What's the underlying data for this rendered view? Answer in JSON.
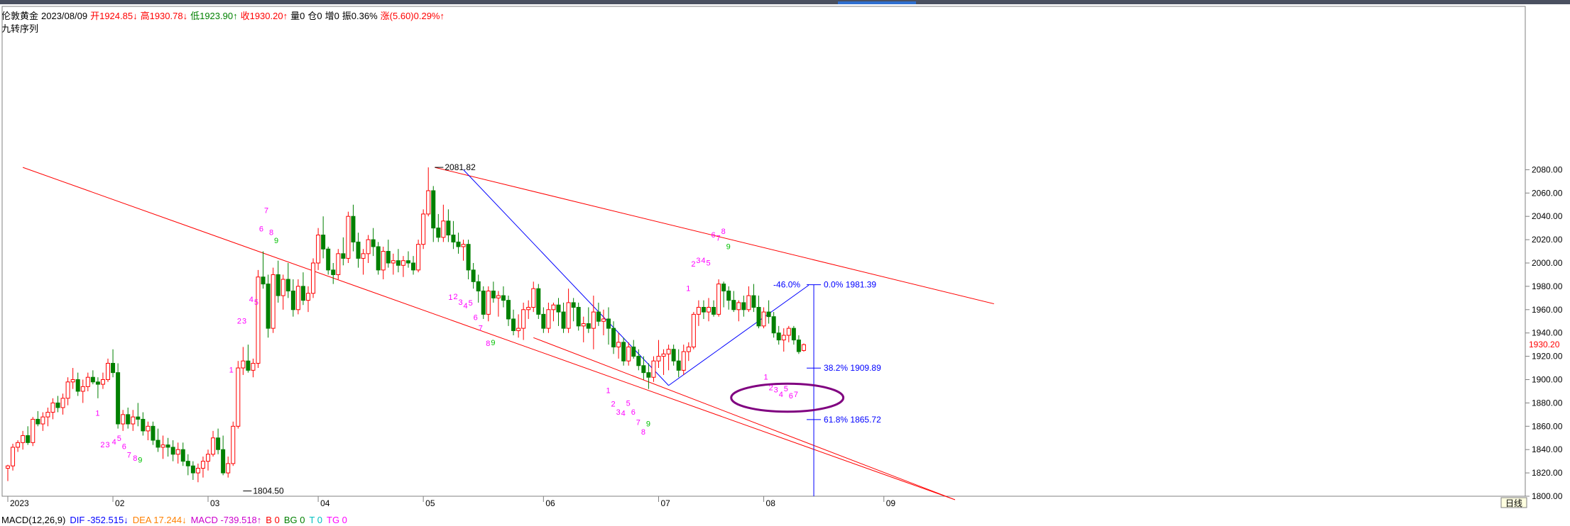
{
  "header": {
    "instrument": "伦敦黄金",
    "date": "2023/08/09",
    "open": "开1924.85↓",
    "high": "高1930.78↓",
    "low": "低1923.90↑",
    "close": "收1930.20↑",
    "volume": "量0",
    "position": "仓0",
    "increase": "增0",
    "amplitude": "振0.36%",
    "change": "涨(5.60)0.29%↑",
    "indicator_name": "九转序列"
  },
  "macd_bar": {
    "name": "MACD(12,26,9)",
    "dif": "DIF -352.515↓",
    "dea": "DEA 17.244↓",
    "macd": "MACD -739.518↑",
    "b": "B 0",
    "bg": "BG 0",
    "t": "T 0",
    "tg": "TG 0"
  },
  "colors": {
    "up": "#ff0000",
    "down": "#008000",
    "channel": "#ff0000",
    "fib": "#0000ff",
    "ellipse": "#800080",
    "td": "#ff00ff",
    "td9": "#00c000"
  },
  "chart_data": {
    "type": "candlestick",
    "ylim": [
      1800,
      2090
    ],
    "ytick_values": [
      1800,
      1820,
      1840,
      1860,
      1880,
      1900,
      1920,
      1940,
      1960,
      1980,
      2000,
      2020,
      2040,
      2060,
      2080
    ],
    "ytick_labels": [
      "1800.00",
      "1820.00",
      "1840.00",
      "1860.00",
      "1880.00",
      "1900.00",
      "1920.00",
      "1940.00",
      "1960.00",
      "1980.00",
      "2000.00",
      "2020.00",
      "2040.00",
      "2060.00",
      "2080.00"
    ],
    "x_labels": [
      {
        "i": 0,
        "t": "2023"
      },
      {
        "i": 21,
        "t": "02"
      },
      {
        "i": 40,
        "t": "03"
      },
      {
        "i": 62,
        "t": "04"
      },
      {
        "i": 83,
        "t": "05"
      },
      {
        "i": 107,
        "t": "06"
      },
      {
        "i": 130,
        "t": "07"
      },
      {
        "i": 151,
        "t": "08"
      },
      {
        "i": 175,
        "t": "09"
      }
    ],
    "x_period_label": "日线",
    "last_price_label": "1930.20",
    "candles": [
      [
        1824,
        1827,
        1813,
        1826
      ],
      [
        1826,
        1845,
        1822,
        1842
      ],
      [
        1842,
        1848,
        1838,
        1846
      ],
      [
        1846,
        1856,
        1840,
        1852
      ],
      [
        1852,
        1860,
        1844,
        1846
      ],
      [
        1846,
        1868,
        1843,
        1866
      ],
      [
        1866,
        1873,
        1860,
        1862
      ],
      [
        1862,
        1872,
        1856,
        1868
      ],
      [
        1868,
        1876,
        1860,
        1872
      ],
      [
        1872,
        1884,
        1866,
        1880
      ],
      [
        1880,
        1886,
        1872,
        1876
      ],
      [
        1876,
        1888,
        1870,
        1884
      ],
      [
        1884,
        1902,
        1878,
        1898
      ],
      [
        1898,
        1910,
        1892,
        1900
      ],
      [
        1900,
        1906,
        1886,
        1890
      ],
      [
        1890,
        1900,
        1880,
        1894
      ],
      [
        1894,
        1906,
        1890,
        1902
      ],
      [
        1902,
        1908,
        1896,
        1898
      ],
      [
        1898,
        1902,
        1884,
        1896
      ],
      [
        1896,
        1906,
        1892,
        1900
      ],
      [
        1900,
        1918,
        1898,
        1914
      ],
      [
        1914,
        1926,
        1902,
        1906
      ],
      [
        1906,
        1914,
        1858,
        1862
      ],
      [
        1862,
        1874,
        1856,
        1870
      ],
      [
        1870,
        1876,
        1858,
        1862
      ],
      [
        1862,
        1874,
        1856,
        1868
      ],
      [
        1868,
        1880,
        1860,
        1866
      ],
      [
        1866,
        1872,
        1852,
        1856
      ],
      [
        1856,
        1864,
        1848,
        1860
      ],
      [
        1860,
        1864,
        1844,
        1848
      ],
      [
        1848,
        1858,
        1838,
        1842
      ],
      [
        1842,
        1852,
        1832,
        1844
      ],
      [
        1844,
        1850,
        1834,
        1842
      ],
      [
        1842,
        1848,
        1830,
        1836
      ],
      [
        1836,
        1846,
        1828,
        1840
      ],
      [
        1840,
        1846,
        1826,
        1830
      ],
      [
        1830,
        1836,
        1818,
        1826
      ],
      [
        1826,
        1830,
        1814,
        1820
      ],
      [
        1820,
        1828,
        1812,
        1824
      ],
      [
        1824,
        1834,
        1816,
        1830
      ],
      [
        1830,
        1840,
        1822,
        1836
      ],
      [
        1836,
        1856,
        1834,
        1850
      ],
      [
        1850,
        1858,
        1836,
        1840
      ],
      [
        1840,
        1852,
        1818,
        1820
      ],
      [
        1820,
        1834,
        1816,
        1828
      ],
      [
        1828,
        1864,
        1826,
        1860
      ],
      [
        1860,
        1916,
        1858,
        1910
      ],
      [
        1910,
        1928,
        1904,
        1916
      ],
      [
        1916,
        1930,
        1906,
        1908
      ],
      [
        1908,
        1918,
        1902,
        1914
      ],
      [
        1914,
        1994,
        1910,
        1988
      ],
      [
        1988,
        2010,
        1978,
        1982
      ],
      [
        1982,
        1990,
        1936,
        1944
      ],
      [
        1944,
        1996,
        1940,
        1990
      ],
      [
        1990,
        2002,
        1966,
        1972
      ],
      [
        1972,
        1990,
        1960,
        1986
      ],
      [
        1986,
        2000,
        1970,
        1976
      ],
      [
        1976,
        1986,
        1954,
        1960
      ],
      [
        1960,
        1986,
        1956,
        1980
      ],
      [
        1980,
        1992,
        1964,
        1968
      ],
      [
        1968,
        1980,
        1958,
        1974
      ],
      [
        1974,
        2004,
        1970,
        2000
      ],
      [
        2000,
        2030,
        1994,
        2024
      ],
      [
        2024,
        2040,
        2004,
        2012
      ],
      [
        2012,
        2014,
        1990,
        1994
      ],
      [
        1994,
        2000,
        1982,
        1990
      ],
      [
        1990,
        2012,
        1986,
        2008
      ],
      [
        2008,
        2022,
        1998,
        2004
      ],
      [
        2004,
        2044,
        2000,
        2040
      ],
      [
        2040,
        2050,
        2010,
        2018
      ],
      [
        2018,
        2026,
        1996,
        2004
      ],
      [
        2004,
        2012,
        1990,
        2008
      ],
      [
        2008,
        2024,
        2000,
        2020
      ],
      [
        2020,
        2030,
        2006,
        2014
      ],
      [
        2014,
        2018,
        1990,
        1994
      ],
      [
        1994,
        2014,
        1986,
        2010
      ],
      [
        2010,
        2020,
        1996,
        2000
      ],
      [
        2000,
        2008,
        1990,
        2002
      ],
      [
        2002,
        2012,
        1992,
        1998
      ],
      [
        1998,
        2006,
        1988,
        2002
      ],
      [
        2002,
        2010,
        1996,
        2000
      ],
      [
        2000,
        2006,
        1990,
        1994
      ],
      [
        1994,
        2020,
        1992,
        2016
      ],
      [
        2016,
        2046,
        2012,
        2042
      ],
      [
        2042,
        2082,
        2040,
        2062
      ],
      [
        2062,
        2066,
        2018,
        2030
      ],
      [
        2030,
        2042,
        2018,
        2022
      ],
      [
        2022,
        2050,
        2018,
        2036
      ],
      [
        2036,
        2046,
        2018,
        2024
      ],
      [
        2024,
        2036,
        2012,
        2018
      ],
      [
        2018,
        2026,
        2008,
        2014
      ],
      [
        2014,
        2020,
        2002,
        2016
      ],
      [
        2016,
        2020,
        1986,
        1994
      ],
      [
        1994,
        2000,
        1978,
        1984
      ],
      [
        1984,
        1990,
        1966,
        1976
      ],
      [
        1976,
        1980,
        1952,
        1956
      ],
      [
        1956,
        1980,
        1950,
        1976
      ],
      [
        1976,
        1984,
        1966,
        1970
      ],
      [
        1970,
        1976,
        1954,
        1972
      ],
      [
        1972,
        1980,
        1962,
        1968
      ],
      [
        1968,
        1972,
        1946,
        1952
      ],
      [
        1952,
        1960,
        1938,
        1942
      ],
      [
        1942,
        1956,
        1936,
        1944
      ],
      [
        1944,
        1966,
        1934,
        1960
      ],
      [
        1960,
        1968,
        1952,
        1962
      ],
      [
        1962,
        1984,
        1958,
        1978
      ],
      [
        1978,
        1982,
        1952,
        1956
      ],
      [
        1956,
        1962,
        1940,
        1944
      ],
      [
        1944,
        1966,
        1940,
        1960
      ],
      [
        1960,
        1966,
        1950,
        1964
      ],
      [
        1964,
        1970,
        1946,
        1958
      ],
      [
        1958,
        1966,
        1940,
        1944
      ],
      [
        1944,
        1978,
        1940,
        1966
      ],
      [
        1966,
        1970,
        1950,
        1962
      ],
      [
        1962,
        1966,
        1942,
        1946
      ],
      [
        1946,
        1954,
        1932,
        1948
      ],
      [
        1948,
        1962,
        1940,
        1944
      ],
      [
        1944,
        1972,
        1926,
        1958
      ],
      [
        1958,
        1966,
        1946,
        1950
      ],
      [
        1950,
        1960,
        1938,
        1952
      ],
      [
        1952,
        1962,
        1930,
        1944
      ],
      [
        1944,
        1950,
        1922,
        1928
      ],
      [
        1928,
        1940,
        1918,
        1932
      ],
      [
        1932,
        1936,
        1912,
        1916
      ],
      [
        1916,
        1932,
        1912,
        1928
      ],
      [
        1928,
        1934,
        1918,
        1920
      ],
      [
        1920,
        1926,
        1908,
        1912
      ],
      [
        1912,
        1920,
        1900,
        1906
      ],
      [
        1906,
        1914,
        1892,
        1902
      ],
      [
        1902,
        1920,
        1898,
        1916
      ],
      [
        1916,
        1934,
        1910,
        1920
      ],
      [
        1920,
        1926,
        1904,
        1922
      ],
      [
        1922,
        1930,
        1908,
        1926
      ],
      [
        1926,
        1930,
        1912,
        1916
      ],
      [
        1916,
        1926,
        1902,
        1908
      ],
      [
        1908,
        1930,
        1904,
        1924
      ],
      [
        1924,
        1932,
        1916,
        1928
      ],
      [
        1928,
        1958,
        1926,
        1956
      ],
      [
        1956,
        1968,
        1946,
        1962
      ],
      [
        1962,
        1968,
        1952,
        1958
      ],
      [
        1958,
        1970,
        1950,
        1962
      ],
      [
        1962,
        1968,
        1954,
        1956
      ],
      [
        1956,
        1986,
        1954,
        1982
      ],
      [
        1982,
        1984,
        1962,
        1976
      ],
      [
        1976,
        1980,
        1960,
        1968
      ],
      [
        1968,
        1976,
        1958,
        1960
      ],
      [
        1960,
        1968,
        1950,
        1966
      ],
      [
        1966,
        1972,
        1954,
        1960
      ],
      [
        1960,
        1980,
        1958,
        1972
      ],
      [
        1972,
        1982,
        1958,
        1962
      ],
      [
        1962,
        1972,
        1944,
        1946
      ],
      [
        1946,
        1962,
        1944,
        1958
      ],
      [
        1958,
        1968,
        1948,
        1954
      ],
      [
        1954,
        1958,
        1936,
        1940
      ],
      [
        1940,
        1946,
        1930,
        1934
      ],
      [
        1934,
        1944,
        1924,
        1938
      ],
      [
        1938,
        1946,
        1932,
        1944
      ],
      [
        1944,
        1946,
        1930,
        1934
      ],
      [
        1934,
        1938,
        1922,
        1924
      ],
      [
        1925,
        1931,
        1924,
        1930
      ]
    ],
    "annotations": [
      {
        "text": "1804.50",
        "x": 47,
        "y": 1804.5
      },
      {
        "text": "2081.82",
        "x": 85.3,
        "y": 2082
      }
    ],
    "channel": {
      "upper": [
        {
          "x": 85.3,
          "y": 2082
        },
        {
          "x": 197,
          "y": 1965
        }
      ],
      "lower": [
        {
          "x": 3,
          "y": 2082
        },
        {
          "x": 189.2,
          "y": 1797
        }
      ],
      "lower2": [
        {
          "x": 105,
          "y": 1936
        },
        {
          "x": 189.2,
          "y": 1797
        }
      ]
    },
    "trend_lines": [
      {
        "from": {
          "x": 91,
          "y": 2080
        },
        "to": {
          "x": 132,
          "y": 1895
        }
      },
      {
        "from": {
          "x": 132,
          "y": 1895
        },
        "to": {
          "x": 160,
          "y": 1981
        }
      }
    ],
    "fib": {
      "x": 161,
      "top": 1981.39,
      "bottom": 1800,
      "levels": [
        {
          "label": "0.0% 1981.39",
          "y": 1981.39
        },
        {
          "label": "38.2% 1909.89",
          "y": 1909.89
        },
        {
          "label": "61.8% 1865.72",
          "y": 1865.72
        }
      ],
      "pct_label": "-46.0%"
    },
    "ellipse": {
      "cx": 155.7,
      "cy": 1884.5,
      "rx": 11.2,
      "ry": 12
    },
    "td_counts": [
      {
        "t": "1",
        "x": 17.5,
        "y": 1869
      },
      {
        "t": "2",
        "x": 18.5,
        "y": 1842
      },
      {
        "t": "3",
        "x": 19.5,
        "y": 1842
      },
      {
        "t": "4",
        "x": 20.8,
        "y": 1844.5
      },
      {
        "t": "5",
        "x": 21.8,
        "y": 1847.5
      },
      {
        "t": "6",
        "x": 22.8,
        "y": 1840.5
      },
      {
        "t": "7",
        "x": 23.8,
        "y": 1833
      },
      {
        "t": "8",
        "x": 25,
        "y": 1830.5
      },
      {
        "t": "9",
        "x": 26,
        "y": 1829
      },
      {
        "t": "1",
        "x": 44.2,
        "y": 1906
      },
      {
        "t": "2",
        "x": 45.8,
        "y": 1948
      },
      {
        "t": "3",
        "x": 46.8,
        "y": 1948
      },
      {
        "t": "4",
        "x": 48.2,
        "y": 1966.5
      },
      {
        "t": "5",
        "x": 49.2,
        "y": 1964
      },
      {
        "t": "6",
        "x": 50.2,
        "y": 2027
      },
      {
        "t": "7",
        "x": 51.2,
        "y": 2043
      },
      {
        "t": "8",
        "x": 52.2,
        "y": 2024
      },
      {
        "t": "9",
        "x": 53.2,
        "y": 2017
      },
      {
        "t": "1",
        "x": 88,
        "y": 1968.5
      },
      {
        "t": "2",
        "x": 89,
        "y": 1969
      },
      {
        "t": "3",
        "x": 90,
        "y": 1964
      },
      {
        "t": "4",
        "x": 91,
        "y": 1961
      },
      {
        "t": "5",
        "x": 92,
        "y": 1963.5
      },
      {
        "t": "6",
        "x": 93,
        "y": 1951
      },
      {
        "t": "7",
        "x": 94,
        "y": 1942
      },
      {
        "t": "8",
        "x": 95.5,
        "y": 1929
      },
      {
        "t": "9",
        "x": 96.5,
        "y": 1929.5
      },
      {
        "t": "1",
        "x": 119.5,
        "y": 1888.5
      },
      {
        "t": "2",
        "x": 120.5,
        "y": 1877
      },
      {
        "t": "3",
        "x": 121.5,
        "y": 1870
      },
      {
        "t": "4",
        "x": 122.5,
        "y": 1869
      },
      {
        "t": "5",
        "x": 123.5,
        "y": 1877.5
      },
      {
        "t": "6",
        "x": 124.5,
        "y": 1870
      },
      {
        "t": "7",
        "x": 125.5,
        "y": 1861
      },
      {
        "t": "8",
        "x": 126.5,
        "y": 1853
      },
      {
        "t": "9",
        "x": 127.5,
        "y": 1860
      },
      {
        "t": "1",
        "x": 135.5,
        "y": 1976
      },
      {
        "t": "2",
        "x": 136.5,
        "y": 1997
      },
      {
        "t": "3",
        "x": 137.5,
        "y": 2000
      },
      {
        "t": "4",
        "x": 138.5,
        "y": 2000
      },
      {
        "t": "5",
        "x": 139.5,
        "y": 1998
      },
      {
        "t": "6",
        "x": 140.5,
        "y": 2022
      },
      {
        "t": "7",
        "x": 141.5,
        "y": 2019
      },
      {
        "t": "8",
        "x": 142.5,
        "y": 2025
      },
      {
        "t": "9",
        "x": 143.5,
        "y": 2012
      },
      {
        "t": "1",
        "x": 151,
        "y": 1900
      },
      {
        "t": "2",
        "x": 152,
        "y": 1891
      },
      {
        "t": "3",
        "x": 153,
        "y": 1889
      },
      {
        "t": "4",
        "x": 154,
        "y": 1885
      },
      {
        "t": "5",
        "x": 155,
        "y": 1890
      },
      {
        "t": "6",
        "x": 156,
        "y": 1884
      },
      {
        "t": "7",
        "x": 157,
        "y": 1885
      }
    ]
  }
}
